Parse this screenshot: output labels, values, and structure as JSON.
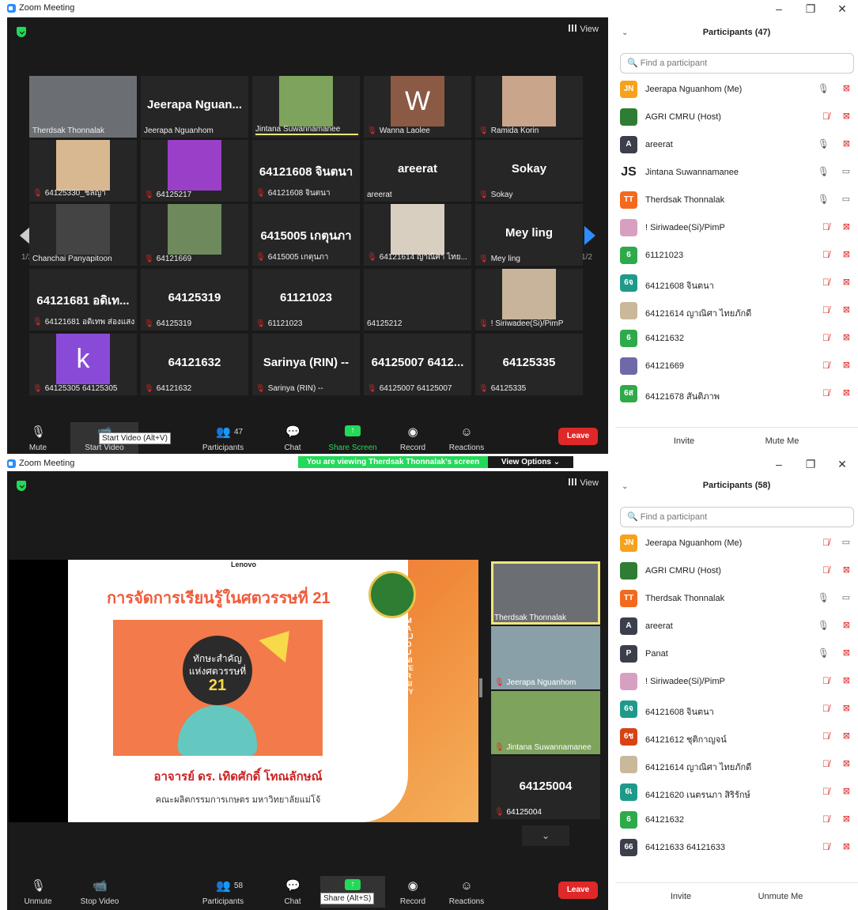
{
  "win1": {
    "title": "Zoom Meeting",
    "view_label": "View",
    "page_left": "1/2",
    "page_right": "1/2",
    "tiles": [
      {
        "big": "",
        "label": "Therdsak Thonnalak",
        "muted": false,
        "photo": "#6b6f74"
      },
      {
        "big": "Jeerapa  Nguan...",
        "label": "Jeerapa Nguanhom",
        "muted": false,
        "photo": ""
      },
      {
        "big": "",
        "label": "Jintana Suwannamanee",
        "muted": false,
        "photo": "#7ea35c"
      },
      {
        "big": "",
        "label": "Wanna Laolee",
        "muted": true,
        "photo": "#8a5a44"
      },
      {
        "big": "",
        "label": "Ramida Korin",
        "muted": true,
        "photo": "#c9a58c"
      },
      {
        "big": "",
        "label": "64125330_ชลญา",
        "muted": true,
        "photo": "#d8b890"
      },
      {
        "big": "",
        "label": "64125217",
        "muted": true,
        "photo": "#9a40c8"
      },
      {
        "big": "64121608 จินตนา",
        "label": "64121608 จินตนา",
        "muted": true,
        "photo": ""
      },
      {
        "big": "areerat",
        "label": "areerat",
        "muted": false,
        "photo": ""
      },
      {
        "big": "Sokay",
        "label": "Sokay",
        "muted": true,
        "photo": ""
      },
      {
        "big": "",
        "label": "Chanchai Panyapitoon",
        "muted": false,
        "photo": "#444"
      },
      {
        "big": "",
        "label": "64121669",
        "muted": true,
        "photo": "#6e8a5c"
      },
      {
        "big": "6415005 เกตุนภา",
        "label": "6415005 เกตุนภา",
        "muted": true,
        "photo": ""
      },
      {
        "big": "",
        "label": "64121614 ญาณิศา ไทย...",
        "muted": true,
        "photo": "#d8cfc0"
      },
      {
        "big": "Mey ling",
        "label": "Mey ling",
        "muted": true,
        "photo": ""
      },
      {
        "big": "64121681 อดิเท...",
        "label": "64121681 อดิเทพ ส่องแสง",
        "muted": true,
        "photo": ""
      },
      {
        "big": "64125319",
        "label": "64125319",
        "muted": true,
        "photo": ""
      },
      {
        "big": "61121023",
        "label": "61121023",
        "muted": true,
        "photo": ""
      },
      {
        "big": "",
        "label": "64125212",
        "muted": false,
        "photo": ""
      },
      {
        "big": "",
        "label": "! Siriwadee(Si)/PimP",
        "muted": true,
        "photo": "#c8b49a"
      },
      {
        "big": "",
        "label": "64125305 64125305",
        "muted": true,
        "photo": "#8a4ad8"
      },
      {
        "big": "64121632",
        "label": "64121632",
        "muted": true,
        "photo": ""
      },
      {
        "big": "Sarinya (RIN) --",
        "label": "Sarinya (RIN) --",
        "muted": true,
        "photo": ""
      },
      {
        "big": "64125007  6412...",
        "label": "64125007 64125007",
        "muted": true,
        "photo": ""
      },
      {
        "big": "64125335",
        "label": "64125335",
        "muted": true,
        "photo": ""
      }
    ],
    "avatar_letters": {
      "wanna": "W",
      "k": "k"
    },
    "toolbar": {
      "mute": "Mute",
      "start_video": "Start Video",
      "participants": "Participants",
      "participants_count": "47",
      "chat": "Chat",
      "share": "Share Screen",
      "record": "Record",
      "reactions": "Reactions",
      "leave": "Leave",
      "tooltip": "Start Video (Alt+V)"
    },
    "panel": {
      "title": "Participants (47)",
      "search_placeholder": "Find a participant",
      "invite": "Invite",
      "mute_all": "Mute Me",
      "people": [
        {
          "initials": "JN",
          "color": "#f7a21b",
          "name": "Jeerapa Nguanhom (Me)",
          "mic": "on",
          "cam": "off"
        },
        {
          "initials": "",
          "color": "#2e7d32",
          "name": "AGRI CMRU (Host)",
          "mic": "off",
          "cam": "off"
        },
        {
          "initials": "A",
          "color": "#3a3f4b",
          "name": "areerat",
          "mic": "on",
          "cam": "off"
        },
        {
          "initials": "JS",
          "color": "#ffffff",
          "name": "Jintana Suwannamanee",
          "mic": "on",
          "cam": "on"
        },
        {
          "initials": "TT",
          "color": "#f36a1e",
          "name": "Therdsak Thonnalak",
          "mic": "on",
          "cam": "on"
        },
        {
          "initials": "",
          "color": "#d8a0c0",
          "name": "! Siriwadee(Si)/PimP",
          "mic": "off",
          "cam": "off"
        },
        {
          "initials": "6",
          "color": "#2eaa4a",
          "name": "61121023",
          "mic": "off",
          "cam": "off"
        },
        {
          "initials": "6จ",
          "color": "#1f9a8a",
          "name": "64121608 จินตนา",
          "mic": "off",
          "cam": "off"
        },
        {
          "initials": "",
          "color": "#c9b89a",
          "name": "64121614 ญาณิศา ไทยภักดี",
          "mic": "off",
          "cam": "off"
        },
        {
          "initials": "6",
          "color": "#2eaa4a",
          "name": "64121632",
          "mic": "off",
          "cam": "off"
        },
        {
          "initials": "",
          "color": "#6e6aa8",
          "name": "64121669",
          "mic": "off",
          "cam": "off"
        },
        {
          "initials": "6ส",
          "color": "#2eaa4a",
          "name": "64121678 สันติภาพ",
          "mic": "off",
          "cam": "off"
        }
      ]
    }
  },
  "win2": {
    "title": "Zoom Meeting",
    "view_label": "View",
    "banner": "You are viewing Therdsak Thonnalak's screen",
    "view_options": "View Options ⌄",
    "slide": {
      "brand": "Lenovo",
      "title": "การจัดการเรียนรู้ในศตวรรษที่  21",
      "art_line1": "ทักษะสำคัญ",
      "art_line2": "แห่งศตวรรษที่",
      "art_num": "21",
      "presenter": "อาจารย์ ดร. เทิดศักดิ์  โทณลักษณ์",
      "faculty": "คณะผลิตกรรมการเกษตร  มหาวิทยาลัยแม่โจ้",
      "vertical": "MAEJO UNIVERSITY"
    },
    "side_tiles": [
      {
        "label": "Therdsak Thonnalak",
        "muted": false,
        "big": ""
      },
      {
        "label": "Jeerapa Nguanhom",
        "muted": true,
        "big": ""
      },
      {
        "label": "Jintana Suwannamanee",
        "muted": true,
        "big": ""
      },
      {
        "label": "64125004",
        "muted": true,
        "big": "64125004"
      }
    ],
    "toolbar": {
      "unmute": "Unmute",
      "stop_video": "Stop Video",
      "participants": "Participants",
      "participants_count": "58",
      "chat": "Chat",
      "share_tooltip": "Share (Alt+S)",
      "record": "Record",
      "reactions": "Reactions",
      "leave": "Leave"
    },
    "panel": {
      "title": "Participants (58)",
      "search_placeholder": "Find a participant",
      "invite": "Invite",
      "unmute_me": "Unmute Me",
      "people": [
        {
          "initials": "JN",
          "color": "#f7a21b",
          "name": "Jeerapa Nguanhom (Me)",
          "mic": "off",
          "cam": "on"
        },
        {
          "initials": "",
          "color": "#2e7d32",
          "name": "AGRI CMRU (Host)",
          "mic": "off",
          "cam": "off"
        },
        {
          "initials": "TT",
          "color": "#f36a1e",
          "name": "Therdsak Thonnalak",
          "mic": "on",
          "cam": "on"
        },
        {
          "initials": "A",
          "color": "#3a3f4b",
          "name": "areerat",
          "mic": "on",
          "cam": "off"
        },
        {
          "initials": "P",
          "color": "#3a3f4b",
          "name": "Panat",
          "mic": "on",
          "cam": "off"
        },
        {
          "initials": "",
          "color": "#d8a0c0",
          "name": "! Siriwadee(Si)/PimP",
          "mic": "off",
          "cam": "off"
        },
        {
          "initials": "6จ",
          "color": "#1f9a8a",
          "name": "64121608 จินตนา",
          "mic": "off",
          "cam": "off"
        },
        {
          "initials": "6ช",
          "color": "#d84315",
          "name": "64121612 ชุติกาญจน์",
          "mic": "off",
          "cam": "off"
        },
        {
          "initials": "",
          "color": "#c9b89a",
          "name": "64121614 ญาณิศา ไทยภักดี",
          "mic": "off",
          "cam": "off"
        },
        {
          "initials": "6เ",
          "color": "#1f9a8a",
          "name": "64121620 เนตรนภา สิริรักษ์",
          "mic": "off",
          "cam": "off"
        },
        {
          "initials": "6",
          "color": "#2eaa4a",
          "name": "64121632",
          "mic": "off",
          "cam": "off"
        },
        {
          "initials": "66",
          "color": "#3a3f4b",
          "name": "64121633 64121633",
          "mic": "off",
          "cam": "off"
        }
      ]
    }
  }
}
